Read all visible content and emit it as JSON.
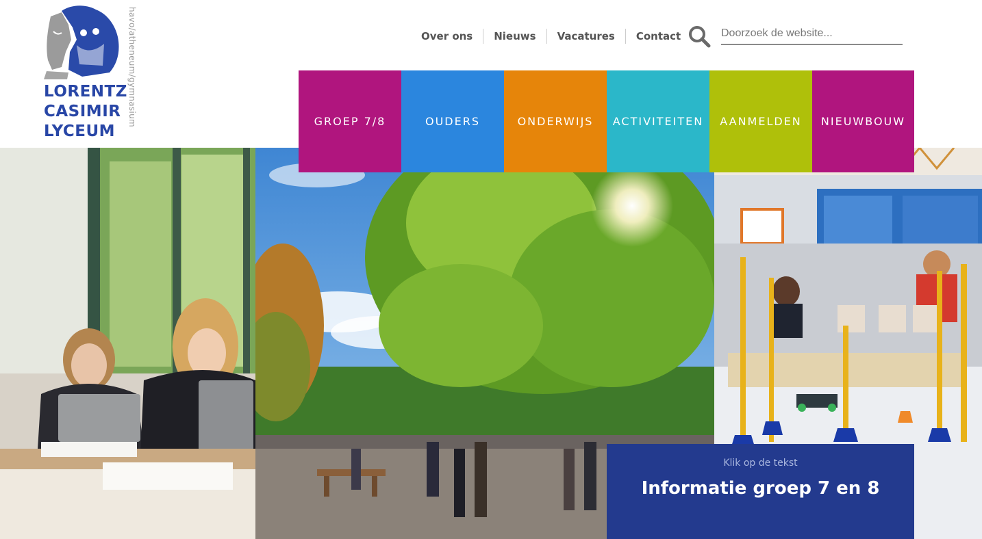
{
  "logo": {
    "lines": [
      "LORENTZ",
      "CASIMIR",
      "LYCEUM"
    ],
    "tagline": "havo/atheneum/gymnasium"
  },
  "top_nav": [
    {
      "label": "Over ons"
    },
    {
      "label": "Nieuws"
    },
    {
      "label": "Vacatures"
    },
    {
      "label": "Contact"
    }
  ],
  "search": {
    "placeholder": "Doorzoek de website...",
    "value": ""
  },
  "tiles": [
    {
      "label": "GROEP 7/8",
      "color": "#b0157e"
    },
    {
      "label": "OUDERS",
      "color": "#2b86de"
    },
    {
      "label": "ONDERWIJS",
      "color": "#e6850a"
    },
    {
      "label": "ACTIVITEITEN",
      "color": "#2bb7c9"
    },
    {
      "label": "AANMELDEN",
      "color": "#afc00a"
    },
    {
      "label": "NIEUWBOUW",
      "color": "#b0157e"
    }
  ],
  "info_box": {
    "subtitle": "Klik op de tekst",
    "title": "Informatie groep 7 en 8",
    "background": "#233a8e"
  },
  "icons": {
    "search": "search-icon",
    "logo_portraits": "portrait-logo-icon"
  }
}
